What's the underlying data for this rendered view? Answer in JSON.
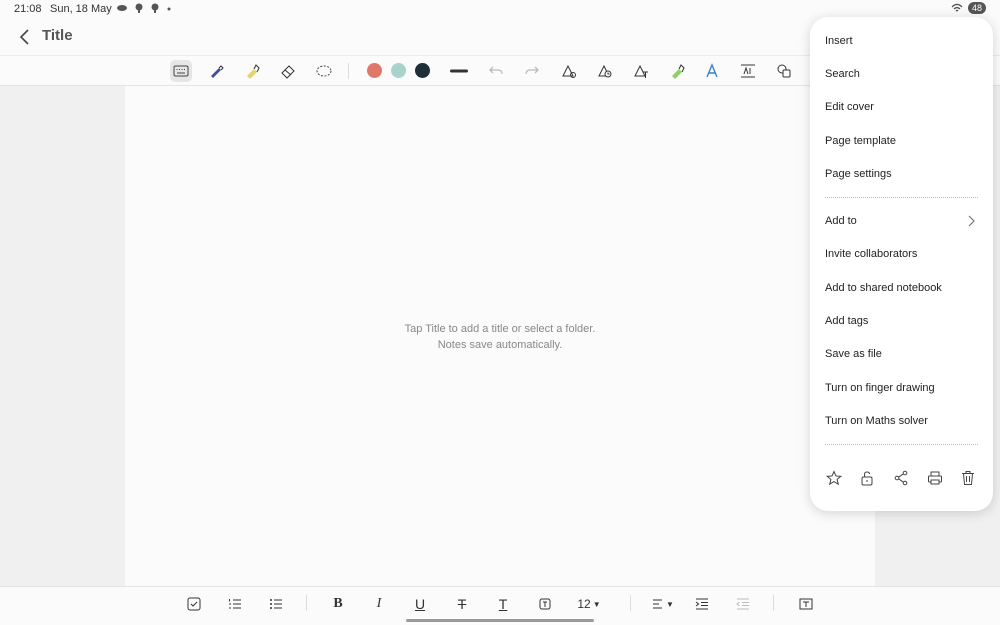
{
  "status": {
    "time": "21:08",
    "date": "Sun, 18 May",
    "battery": "48"
  },
  "header": {
    "title": "Title"
  },
  "toolbar": {
    "tools": [
      "keyboard-icon",
      "pen-icon",
      "highlighter-icon",
      "eraser-icon",
      "lasso-icon"
    ],
    "colors": [
      "#e0776b",
      "#a7d3cc",
      "#1f2f3a"
    ],
    "extra_tools": [
      "undo-icon",
      "redo-icon",
      "shape-pen-icon",
      "pen-clock-icon",
      "text-pen-icon",
      "marker-icon",
      "text-style-icon",
      "text-box-icon",
      "shapes-icon"
    ]
  },
  "canvas": {
    "hint_line1": "Tap Title to add a title or select a folder.",
    "hint_line2": "Notes save automatically."
  },
  "menu": {
    "items_top": [
      "Insert",
      "Search",
      "Edit cover",
      "Page template",
      "Page settings"
    ],
    "items_bottom": [
      "Add to",
      "Invite collaborators",
      "Add to shared notebook",
      "Add tags",
      "Save as file",
      "Turn on finger drawing",
      "Turn on Maths solver"
    ],
    "icons": [
      "star-icon",
      "lock-icon",
      "share-icon",
      "print-icon",
      "trash-icon"
    ]
  },
  "bottom_toolbar": {
    "font_size": "12"
  }
}
